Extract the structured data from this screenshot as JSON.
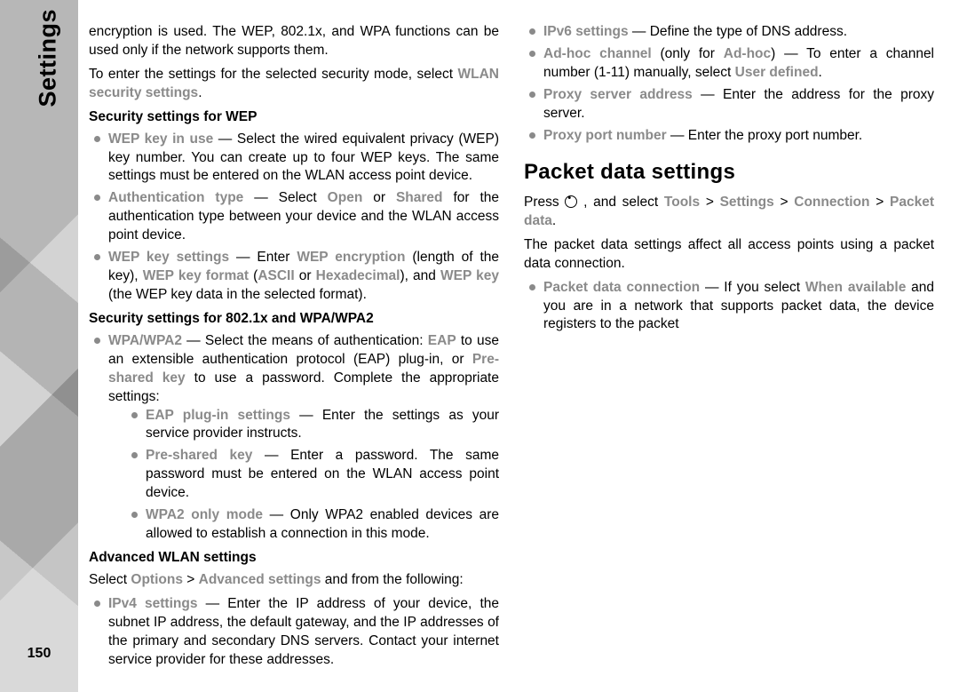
{
  "side": {
    "label": "Settings",
    "page": "150"
  },
  "col1": {
    "intro1": "encryption is used. The WEP, 802.1x, and WPA functions can be used only if the network supports them.",
    "intro2a": "To enter the settings for the selected security mode, select ",
    "intro2_g": "WLAN security settings",
    "intro2b": ".",
    "h_sec_wep": "Security settings for WEP",
    "wep_keyinuse_g": "WEP key in use",
    "wep_keyinuse_t": " — Select the wired equivalent privacy (WEP) key number. You can create up to four WEP keys. The same settings must be entered on the WLAN access point device.",
    "authtype_g": "Authentication type",
    "authtype_mid": " — Select ",
    "authtype_open_g": "Open",
    "authtype_or": " or ",
    "authtype_shared_g": "Shared",
    "authtype_tail": " for the authentication type between your device and the WLAN access point device.",
    "wepkeyset_g": "WEP key settings",
    "wepkeyset_a": " — Enter ",
    "wepkeyset_enc_g": "WEP encryption",
    "wepkeyset_b": " (length of the key), ",
    "wepkeyset_fmt_g": "WEP key format",
    "wepkeyset_c": " (",
    "wepkeyset_ascii_g": "ASCII",
    "wepkeyset_d": " or ",
    "wepkeyset_hex_g": "Hexadecimal",
    "wepkeyset_e": "), and ",
    "wepkeyset_key_g": "WEP key",
    "wepkeyset_f": " (the WEP key data in the selected format).",
    "h_sec_wpa": "Security settings for 802.1x and WPA/WPA2",
    "wpa_g": "WPA/WPA2",
    "wpa_a": " — Select the means of authentication: ",
    "wpa_eap_g": "EAP",
    "wpa_b": " to use an extensible authentication protocol (EAP) plug-in, or ",
    "wpa_psk_g": "Pre-shared key",
    "wpa_c": " to use a password. Complete the appropriate settings:",
    "eapplug_g": "EAP plug-in settings",
    "eapplug_t": " — Enter the settings as your service provider instructs.",
    "psk_g": "Pre-shared key",
    "psk_t": " — Enter a password. The same password must be entered on the WLAN access point device."
  },
  "col2": {
    "wpa2only_g": "WPA2 only mode",
    "wpa2only_t": " — Only WPA2 enabled devices are allowed to establish a connection in this mode.",
    "h_adv_wlan": "Advanced WLAN settings",
    "adv_a": "Select ",
    "adv_opt_g": "Options",
    "adv_gt1": " > ",
    "adv_set_g": "Advanced settings",
    "adv_b": " and from the following:",
    "ipv4_g": "IPv4 settings",
    "ipv4_t": " — Enter the IP address of your device, the subnet IP address, the default gateway, and the IP addresses of the primary and secondary DNS servers. Contact your internet service provider for these addresses.",
    "ipv6_g": "IPv6 settings",
    "ipv6_t": " — Define the type of DNS address.",
    "adhoc_g": "Ad-hoc channel",
    "adhoc_a": " (only for ",
    "adhoc_mode_g": "Ad-hoc",
    "adhoc_b": ") — To enter a channel number (1-11) manually, select ",
    "adhoc_user_g": "User defined",
    "adhoc_c": ".",
    "proxyaddr_g": "Proxy server address",
    "proxyaddr_t": " — Enter the address for the proxy server.",
    "proxyport_g": "Proxy port number",
    "proxyport_t": " — Enter the proxy port number.",
    "h_packet": "Packet data settings",
    "pkt_a": "Press ",
    "pkt_b": " , and select ",
    "pkt_tools_g": "Tools",
    "pkt_gt1": " > ",
    "pkt_set_g": "Settings",
    "pkt_gt2": " > ",
    "pkt_conn_g": "Connection",
    "pkt_gt3": " > ",
    "pkt_pd_g": "Packet data",
    "pkt_c": ".",
    "pkt_desc": "The packet data settings affect all access points using a packet data connection.",
    "pdc_g": "Packet data connection",
    "pdc_a": " — If you select ",
    "pdc_when_g": "When available",
    "pdc_b": " and you are in a network that supports packet data, the device registers to the packet"
  }
}
